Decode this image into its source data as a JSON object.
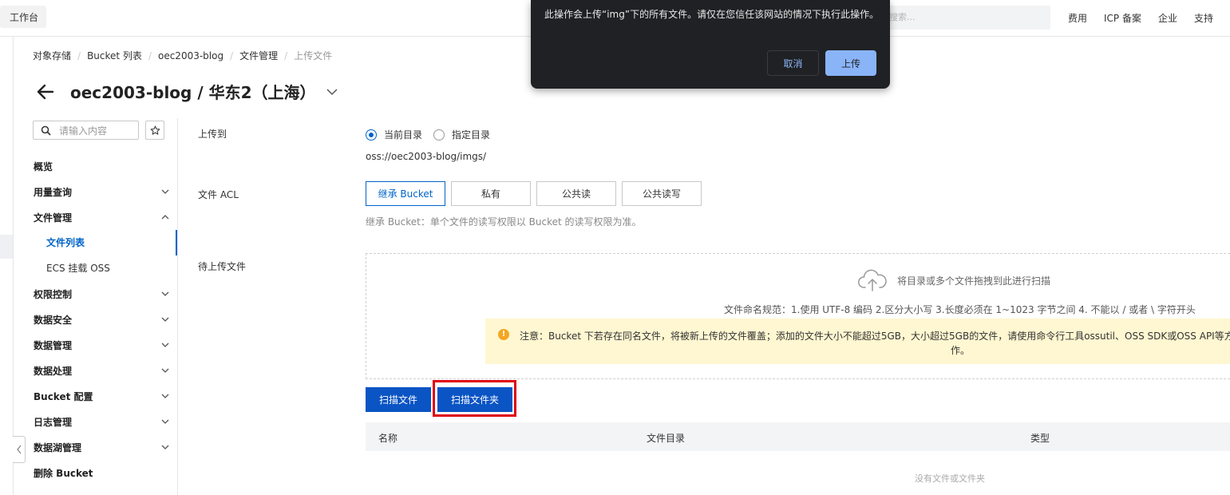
{
  "topbar": {
    "workbench_label": "工作台",
    "search_placeholder": "搜索...",
    "links": [
      "费用",
      "ICP 备案",
      "企业",
      "支持"
    ]
  },
  "breadcrumb": [
    "对象存储",
    "Bucket 列表",
    "oec2003-blog",
    "文件管理",
    "上传文件"
  ],
  "page_title": "oec2003-blog / 华东2（上海）",
  "sidebar": {
    "search_placeholder": "请输入内容",
    "items": [
      {
        "label": "概览"
      },
      {
        "label": "用量查询"
      },
      {
        "label": "文件管理"
      },
      {
        "label": "文件列表"
      },
      {
        "label": "ECS 挂载 OSS"
      },
      {
        "label": "权限控制"
      },
      {
        "label": "数据安全"
      },
      {
        "label": "数据管理"
      },
      {
        "label": "数据处理"
      },
      {
        "label": "Bucket 配置"
      },
      {
        "label": "日志管理"
      },
      {
        "label": "数据湖管理"
      },
      {
        "label": "删除 Bucket"
      }
    ]
  },
  "form": {
    "upload_to_label": "上传到",
    "radio_current": "当前目录",
    "radio_specified": "指定目录",
    "path": "oss://oec2003-blog/imgs/",
    "acl_label": "文件 ACL",
    "acl_options": [
      "继承 Bucket",
      "私有",
      "公共读",
      "公共读写"
    ],
    "acl_hint": "继承 Bucket：单个文件的读写权限以 Bucket 的读写权限为准。",
    "pending_label": "待上传文件",
    "drop_hint": "将目录或多个文件拖拽到此进行扫描",
    "naming_rules": "文件命名规范：1.使用 UTF-8 编码 2.区分大小写 3.长度必须在 1~1023 字节之间 4. 不能以 / 或者 \\ 字符开头",
    "notice_line1": "注意：Bucket 下若存在同名文件，将被新上传的文件覆盖；添加的文件大小不能超过5GB，大小超过5GB的文件，请使用命令行工具ossutil、OSS SDK或OSS API等方式上传",
    "notice_line2": "作。",
    "scan_file_button": "扫描文件",
    "scan_folder_button": "扫描文件夹"
  },
  "table": {
    "columns": [
      "名称",
      "文件目录",
      "类型"
    ],
    "empty_text": "没有文件或文件夹"
  },
  "popup": {
    "message": "此操作会上传“img”下的所有文件。请仅在您信任该网站的情况下执行此操作。",
    "cancel_label": "取消",
    "upload_label": "上传"
  }
}
